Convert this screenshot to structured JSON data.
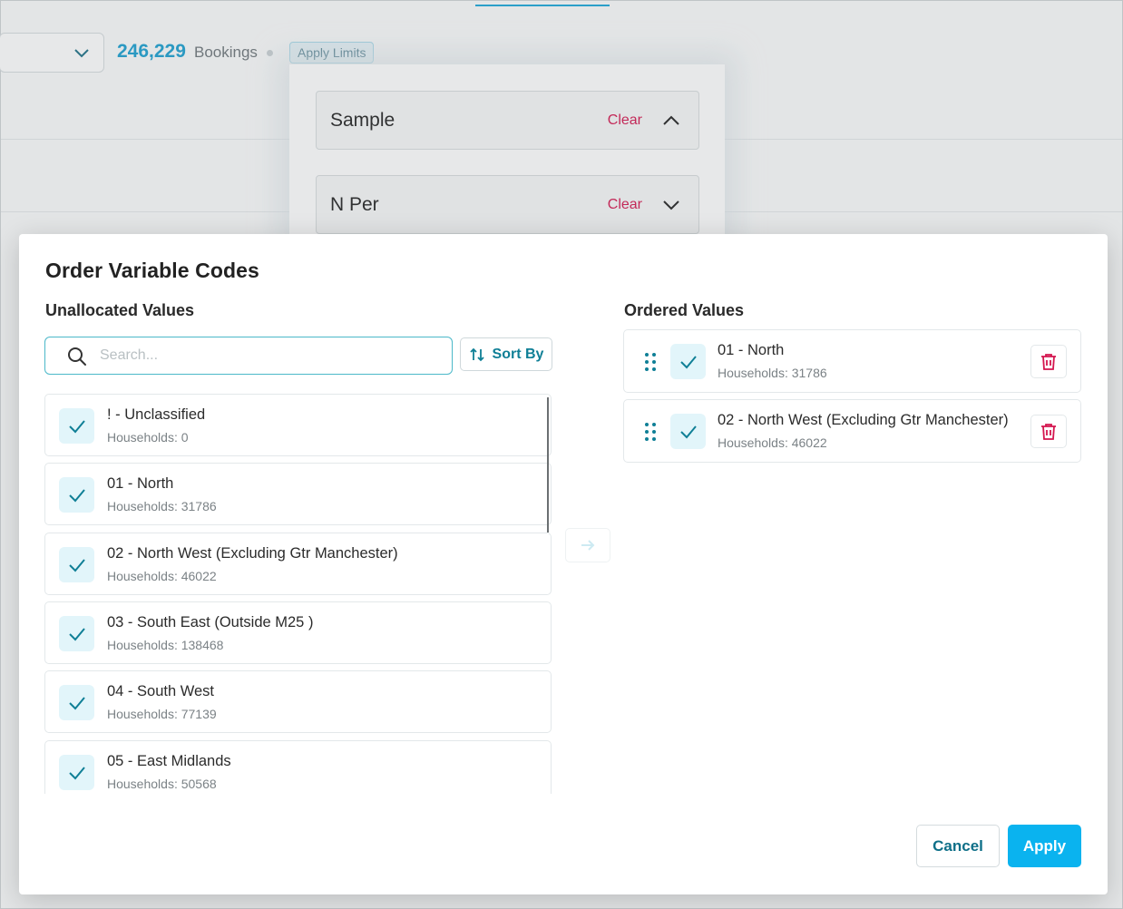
{
  "background": {
    "bookings_count": "246,229",
    "bookings_label": "Bookings",
    "apply_limits_label": "Apply Limits",
    "accordions": [
      {
        "title": "Sample",
        "clear_label": "Clear",
        "expanded": true
      },
      {
        "title": "N Per",
        "clear_label": "Clear",
        "expanded": false
      }
    ]
  },
  "modal": {
    "title": "Order Variable Codes",
    "unallocated_label": "Unallocated Values",
    "ordered_label": "Ordered Values",
    "search": {
      "placeholder": "Search...",
      "value": ""
    },
    "sort_label": "Sort By",
    "unallocated_values": [
      {
        "name": "! - Unclassified",
        "households": "Households: 0",
        "checked": true
      },
      {
        "name": "01 - North",
        "households": "Households: 31786",
        "checked": true
      },
      {
        "name": "02 - North West (Excluding Gtr Manchester)",
        "households": "Households: 46022",
        "checked": true
      },
      {
        "name": "03 - South East (Outside M25 )",
        "households": "Households: 138468",
        "checked": true
      },
      {
        "name": "04 - South West",
        "households": "Households: 77139",
        "checked": true
      },
      {
        "name": "05 - East Midlands",
        "households": "Households: 50568",
        "checked": true
      }
    ],
    "ordered_values": [
      {
        "name": "01 - North",
        "households": "Households: 31786",
        "checked": true
      },
      {
        "name": "02 - North West (Excluding Gtr Manchester)",
        "households": "Households: 46022",
        "checked": true
      }
    ],
    "cancel_label": "Cancel",
    "apply_label": "Apply"
  },
  "colors": {
    "accent": "#0ab3ef",
    "teal": "#0f7f96",
    "danger": "#d4164f",
    "check_bg": "#e2f5fa"
  }
}
